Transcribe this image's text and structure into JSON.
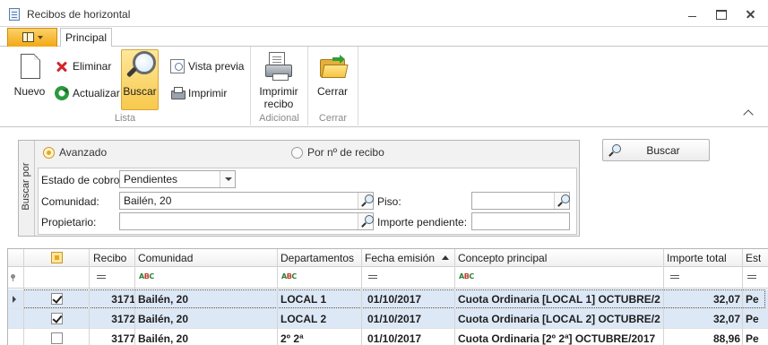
{
  "window": {
    "title": "Recibos de horizontal"
  },
  "ribbon": {
    "tab": "Principal",
    "groups": {
      "lista": {
        "label": "Lista",
        "nuevo": "Nuevo",
        "eliminar": "Eliminar",
        "actualizar": "Actualizar",
        "buscar": "Buscar",
        "vista_previa": "Vista previa",
        "imprimir": "Imprimir"
      },
      "adicional": {
        "label": "Adicional",
        "imprimir_recibo_1": "Imprimir",
        "imprimir_recibo_2": "recibo"
      },
      "cerrar": {
        "label": "Cerrar",
        "cerrar": "Cerrar"
      }
    }
  },
  "search": {
    "section_label": "Buscar por",
    "mode_avanzado": "Avanzado",
    "mode_por_recibo": "Por nº de recibo",
    "selected_mode": "Avanzado",
    "estado_label": "Estado de cobro:",
    "estado_value": "Pendientes",
    "comunidad_label": "Comunidad:",
    "comunidad_value": "Bailén, 20",
    "propietario_label": "Propietario:",
    "propietario_value": "",
    "piso_label": "Piso:",
    "piso_value": "",
    "importe_label": "Importe pendiente:",
    "importe_value": "",
    "buscar_button": "Buscar"
  },
  "grid": {
    "columns": [
      "Recibo",
      "Comunidad",
      "Departamentos",
      "Fecha emisión",
      "Concepto principal",
      "Importe total",
      "Est"
    ],
    "sorted_column": "Fecha emisión",
    "rows": [
      {
        "checked": true,
        "recibo": "3171",
        "comunidad": "Bailén, 20",
        "departamentos": "LOCAL 1",
        "fecha": "01/10/2017",
        "concepto": "Cuota Ordinaria [LOCAL 1] OCTUBRE/2...",
        "importe": "32,07",
        "estado": "Pe"
      },
      {
        "checked": true,
        "recibo": "3172",
        "comunidad": "Bailén, 20",
        "departamentos": "LOCAL 2",
        "fecha": "01/10/2017",
        "concepto": "Cuota Ordinaria [LOCAL 2] OCTUBRE/2...",
        "importe": "32,07",
        "estado": "Pe"
      },
      {
        "checked": false,
        "recibo": "3177",
        "comunidad": "Bailén, 20",
        "departamentos": "2º 2ª",
        "fecha": "01/10/2017",
        "concepto": "Cuota Ordinaria [2º 2ª] OCTUBRE/2017",
        "importe": "88,96",
        "estado": "Pe"
      }
    ]
  },
  "colors": {
    "accent": "#f3a813",
    "selected_row": "#dde8f6",
    "active_button": "#f8c94c"
  }
}
